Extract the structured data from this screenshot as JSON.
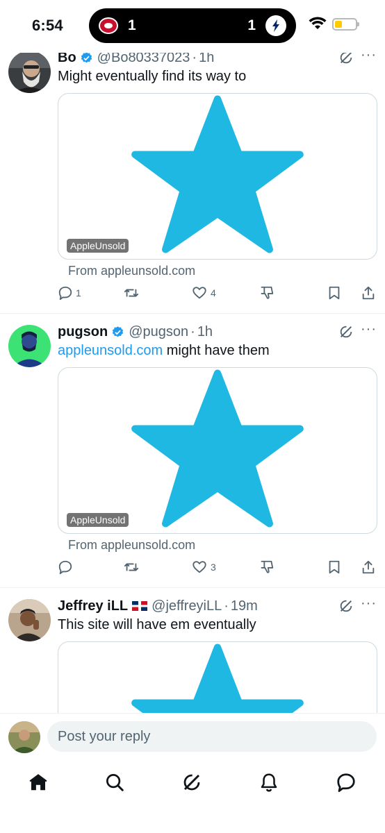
{
  "status_bar": {
    "time": "6:54",
    "score_left": "1",
    "score_right": "1"
  },
  "colors": {
    "accent": "#1d9bf0",
    "star": "#1fb8e2",
    "text_secondary": "#536471"
  },
  "tweets": [
    {
      "name": "Bo",
      "handle": "@Bo80337023",
      "time": "1h",
      "text": "Might eventually find its way to",
      "card_badge": "AppleUnsold",
      "card_source": "From appleunsold.com",
      "replies": "1",
      "retweets": "",
      "likes": "4"
    },
    {
      "name": "pugson",
      "handle": "@pugson",
      "time": "1h",
      "text_link": "appleunsold.com",
      "text": " might have them",
      "card_badge": "AppleUnsold",
      "card_source": "From appleunsold.com",
      "replies": "",
      "retweets": "",
      "likes": "3"
    },
    {
      "name": "Jeffrey iLL",
      "handle": "@jeffreyiLL",
      "time": "19m",
      "text": "This site will have em eventually"
    }
  ],
  "reply": {
    "placeholder": "Post your reply"
  },
  "nav": [
    "home-icon",
    "search-icon",
    "grok-icon",
    "notifications-icon",
    "messages-icon"
  ]
}
